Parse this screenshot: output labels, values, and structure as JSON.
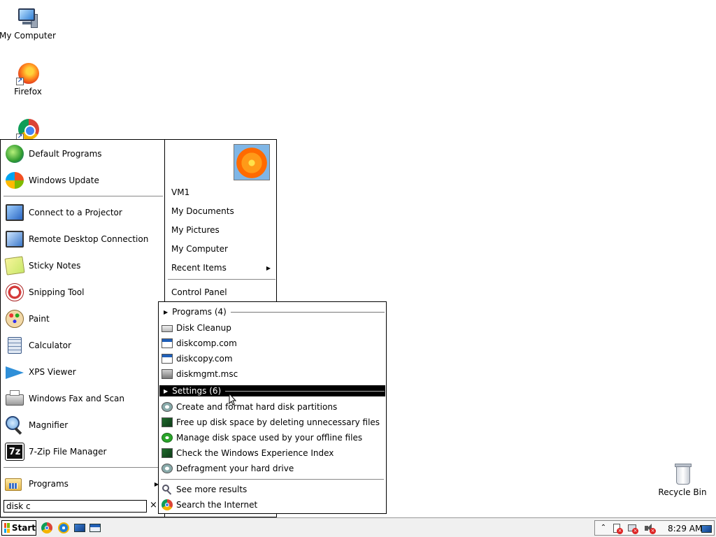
{
  "desktop": {
    "icons": [
      {
        "label": "My Computer",
        "icon": "computer-icon"
      },
      {
        "label": "Firefox",
        "icon": "firefox-icon"
      },
      {
        "label": "Chrome",
        "icon": "chrome-icon"
      },
      {
        "label": "Recycle Bin",
        "icon": "recycle-bin-icon"
      }
    ]
  },
  "start_menu": {
    "pinned": [
      {
        "label": "Default Programs",
        "icon": "default-programs-icon"
      },
      {
        "label": "Windows Update",
        "icon": "windows-update-icon"
      }
    ],
    "recent": [
      {
        "label": "Connect to a Projector",
        "icon": "projector-icon"
      },
      {
        "label": "Remote Desktop Connection",
        "icon": "remote-desktop-icon"
      },
      {
        "label": "Sticky Notes",
        "icon": "sticky-notes-icon"
      },
      {
        "label": "Snipping Tool",
        "icon": "scissors-icon"
      },
      {
        "label": "Paint",
        "icon": "paint-palette-icon"
      },
      {
        "label": "Calculator",
        "icon": "calculator-icon"
      },
      {
        "label": "XPS Viewer",
        "icon": "xps-viewer-icon"
      },
      {
        "label": "Windows Fax and Scan",
        "icon": "fax-icon"
      },
      {
        "label": "Magnifier",
        "icon": "magnifier-icon"
      },
      {
        "label": "7-Zip File Manager",
        "icon": "7zip-icon"
      }
    ],
    "programs_label": "Programs",
    "search_value": "disk c",
    "search_clear": "×",
    "user_name": "VM1",
    "right_items": [
      {
        "label": "My Documents"
      },
      {
        "label": "My Pictures"
      },
      {
        "label": "My Computer"
      },
      {
        "label": "Recent Items"
      }
    ],
    "control_panel": "Control Panel"
  },
  "search_results": {
    "programs_header": "Programs (4)",
    "programs": [
      {
        "label": "Disk Cleanup",
        "icon": "disk-cleanup-icon"
      },
      {
        "label": "diskcomp.com",
        "icon": "app-window-icon"
      },
      {
        "label": "diskcopy.com",
        "icon": "app-window-icon"
      },
      {
        "label": "diskmgmt.msc",
        "icon": "disk-management-icon"
      }
    ],
    "settings_header": "Settings (6)",
    "settings": [
      {
        "label": "Create and format hard disk partitions",
        "icon": "settings-gear-icon"
      },
      {
        "label": "Free up disk space by deleting unnecessary files",
        "icon": "monitor-settings-icon"
      },
      {
        "label": "Manage disk space used by your offline files",
        "icon": "sync-green-icon"
      },
      {
        "label": "Check the Windows Experience Index",
        "icon": "monitor-settings-icon"
      },
      {
        "label": "Defragment your hard drive",
        "icon": "settings-gear-icon"
      }
    ],
    "see_more": "See more results",
    "search_internet": "Search the Internet"
  },
  "taskbar": {
    "start_label": "Start",
    "quick_launch": [
      "chrome-icon",
      "ie-icon",
      "show-desktop-icon",
      "window-switch-icon"
    ],
    "tray": [
      "show-hidden-icons",
      "action-center-icon",
      "network-icon",
      "volume-muted-icon"
    ],
    "clock": "8:29 AM"
  },
  "colors": {
    "highlight_bg": "#000000",
    "highlight_text": "#ffffff",
    "taskbar_bg": "#f0f0f0"
  }
}
